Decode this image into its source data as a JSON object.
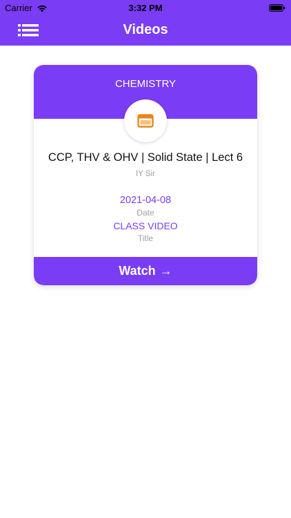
{
  "status_bar": {
    "carrier": "Carrier",
    "time": "3:32 PM"
  },
  "nav": {
    "title": "Videos"
  },
  "card": {
    "subject": "CHEMISTRY",
    "icon": "video-player-icon",
    "lecture_title": "CCP, THV & OHV | Solid State | Lect 6",
    "teacher": "IY Sir",
    "date": "2021-04-08",
    "date_label": "Date",
    "type": "CLASS VIDEO",
    "type_label": "Title",
    "watch_label": "Watch",
    "watch_arrow": "→"
  },
  "colors": {
    "accent": "#7a3cf5",
    "icon_orange": "#e8861a",
    "muted_text": "#a0a0a0"
  }
}
